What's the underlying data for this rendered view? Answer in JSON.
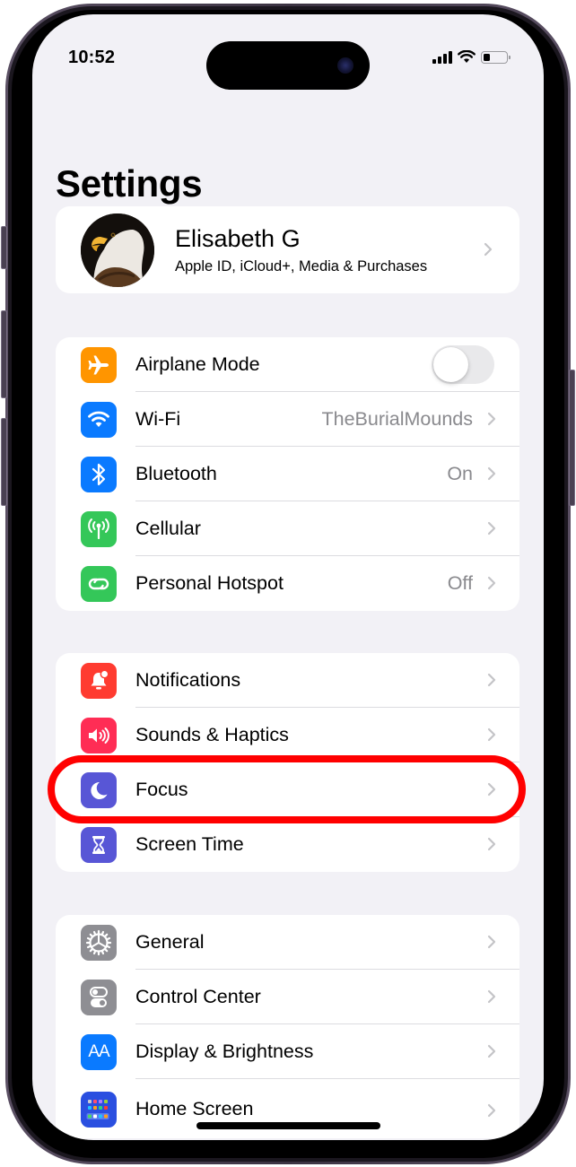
{
  "status_bar": {
    "time": "10:52",
    "signal_bars": 4,
    "wifi_icon": "wifi-icon",
    "battery_level": 0.3
  },
  "header": {
    "title": "Settings"
  },
  "profile": {
    "name": "Elisabeth G",
    "subtitle": "Apple ID, iCloud+, Media & Purchases",
    "avatar_icon": "bald-eagle-avatar"
  },
  "groups": [
    {
      "items": [
        {
          "label": "Airplane Mode",
          "icon": "airplane-icon",
          "color": "#ff9500",
          "toggle": false
        },
        {
          "label": "Wi-Fi",
          "icon": "wifi-icon",
          "color": "#0a7aff",
          "value": "TheBurialMounds"
        },
        {
          "label": "Bluetooth",
          "icon": "bluetooth-icon",
          "color": "#0a7aff",
          "value": "On"
        },
        {
          "label": "Cellular",
          "icon": "cellular-antenna-icon",
          "color": "#34c759",
          "value": ""
        },
        {
          "label": "Personal Hotspot",
          "icon": "hotspot-link-icon",
          "color": "#34c759",
          "value": "Off"
        }
      ]
    },
    {
      "items": [
        {
          "label": "Notifications",
          "icon": "notifications-bell-icon",
          "color": "#ff3b30"
        },
        {
          "label": "Sounds & Haptics",
          "icon": "speaker-icon",
          "color": "#ff2d55"
        },
        {
          "label": "Focus",
          "icon": "moon-icon",
          "color": "#5856d6",
          "highlighted": true
        },
        {
          "label": "Screen Time",
          "icon": "hourglass-icon",
          "color": "#5856d6"
        }
      ]
    },
    {
      "items": [
        {
          "label": "General",
          "icon": "gear-icon",
          "color": "#8e8e93"
        },
        {
          "label": "Control Center",
          "icon": "switches-icon",
          "color": "#8e8e93"
        },
        {
          "label": "Display & Brightness",
          "icon": "text-size-icon",
          "color": "#0a7aff",
          "glyph": "AA"
        },
        {
          "label": "Home Screen",
          "icon": "home-screen-grid-icon",
          "color": "#2a4fe0"
        }
      ]
    }
  ],
  "annotation": {
    "highlight_target": "Focus",
    "highlight_color": "#ff0000"
  }
}
